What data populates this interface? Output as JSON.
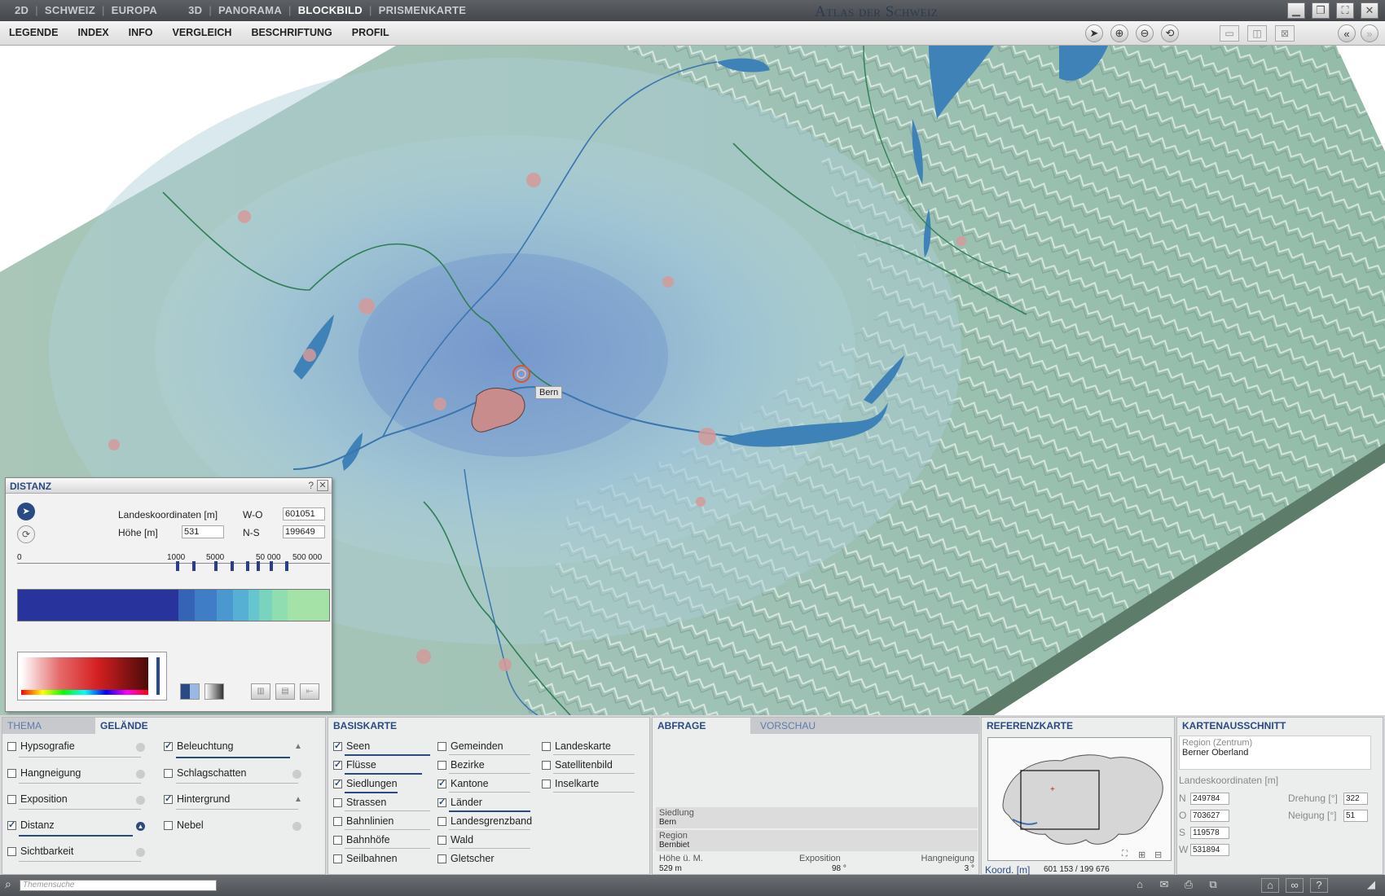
{
  "titlebar": {
    "tabs_2d": [
      "2D",
      "SCHWEIZ",
      "EUROPA"
    ],
    "tabs_3d": [
      "3D",
      "PANORAMA",
      "BLOCKBILD",
      "PRISMENKARTE"
    ],
    "active_tab": "BLOCKBILD",
    "app_title": "Atlas der Schweiz"
  },
  "menu": {
    "items": [
      "LEGENDE",
      "INDEX",
      "INFO",
      "VERGLEICH",
      "BESCHRIFTUNG",
      "PROFIL"
    ]
  },
  "map": {
    "place_label": "Bern"
  },
  "distanz": {
    "title": "DISTANZ",
    "help": "?",
    "close": "✕",
    "coord_label": "Landeskoordinaten [m]",
    "height_label": "Höhe [m]",
    "wo_label": "W-O",
    "ns_label": "N-S",
    "wo_value": "601051",
    "ns_value": "199649",
    "height_value": "531",
    "scale_labels": [
      "0",
      "1000",
      "5000",
      "50 000",
      "500 000"
    ]
  },
  "thema_panel": {
    "tabs": [
      "THEMA",
      "GELÄNDE"
    ],
    "active": "GELÄNDE",
    "col1": [
      {
        "label": "Hypsografie",
        "checked": false
      },
      {
        "label": "Hangneigung",
        "checked": false
      },
      {
        "label": "Exposition",
        "checked": false
      },
      {
        "label": "Distanz",
        "checked": true
      },
      {
        "label": "Sichtbarkeit",
        "checked": false
      }
    ],
    "col2": [
      {
        "label": "Beleuchtung",
        "checked": true
      },
      {
        "label": "Schlagschatten",
        "checked": false
      },
      {
        "label": "Hintergrund",
        "checked": true
      },
      {
        "label": "Nebel",
        "checked": false
      }
    ]
  },
  "basiskarte": {
    "title": "BASISKARTE",
    "col1": [
      {
        "label": "Seen",
        "checked": true
      },
      {
        "label": "Flüsse",
        "checked": true
      },
      {
        "label": "Siedlungen",
        "checked": true
      },
      {
        "label": "Strassen",
        "checked": false
      },
      {
        "label": "Bahnlinien",
        "checked": false
      },
      {
        "label": "Bahnhöfe",
        "checked": false
      },
      {
        "label": "Seilbahnen",
        "checked": false
      }
    ],
    "col2": [
      {
        "label": "Gemeinden",
        "checked": false
      },
      {
        "label": "Bezirke",
        "checked": false
      },
      {
        "label": "Kantone",
        "checked": true
      },
      {
        "label": "Länder",
        "checked": true
      },
      {
        "label": "Landesgrenzband",
        "checked": false
      },
      {
        "label": "Wald",
        "checked": false
      },
      {
        "label": "Gletscher",
        "checked": false
      }
    ],
    "col3": [
      {
        "label": "Landeskarte",
        "checked": false
      },
      {
        "label": "Satellitenbild",
        "checked": false
      },
      {
        "label": "Inselkarte",
        "checked": false
      }
    ]
  },
  "abfrage": {
    "tabs": [
      "ABFRAGE",
      "VORSCHAU"
    ],
    "siedlung_label": "Siedlung",
    "siedlung_value": "Bern",
    "region_label": "Region",
    "region_value": "Bernbiet",
    "hoehe_label": "Höhe ü. M.",
    "hoehe_value": "529 m",
    "exposition_label": "Exposition",
    "exposition_value": "98 °",
    "hangneigung_label": "Hangneigung",
    "hangneigung_value": "3 °"
  },
  "referenzkarte": {
    "title": "REFERENZKARTE",
    "koord_label": "Koord. [m]",
    "koord_value": "601 153 / 199 676"
  },
  "kartenausschnitt": {
    "title": "KARTENAUSSCHNITT",
    "region_label": "Region (Zentrum)",
    "region_value": "Berner Oberland",
    "coord_label": "Landeskoordinaten [m]",
    "n_label": "N",
    "n_value": "249784",
    "o_label": "O",
    "o_value": "703627",
    "s_label": "S",
    "s_value": "119578",
    "w_label": "W",
    "w_value": "531894",
    "drehung_label": "Drehung [°]",
    "drehung_value": "322",
    "neigung_label": "Neigung [°]",
    "neigung_value": "51"
  },
  "statusbar": {
    "search_placeholder": "Themensuche"
  }
}
